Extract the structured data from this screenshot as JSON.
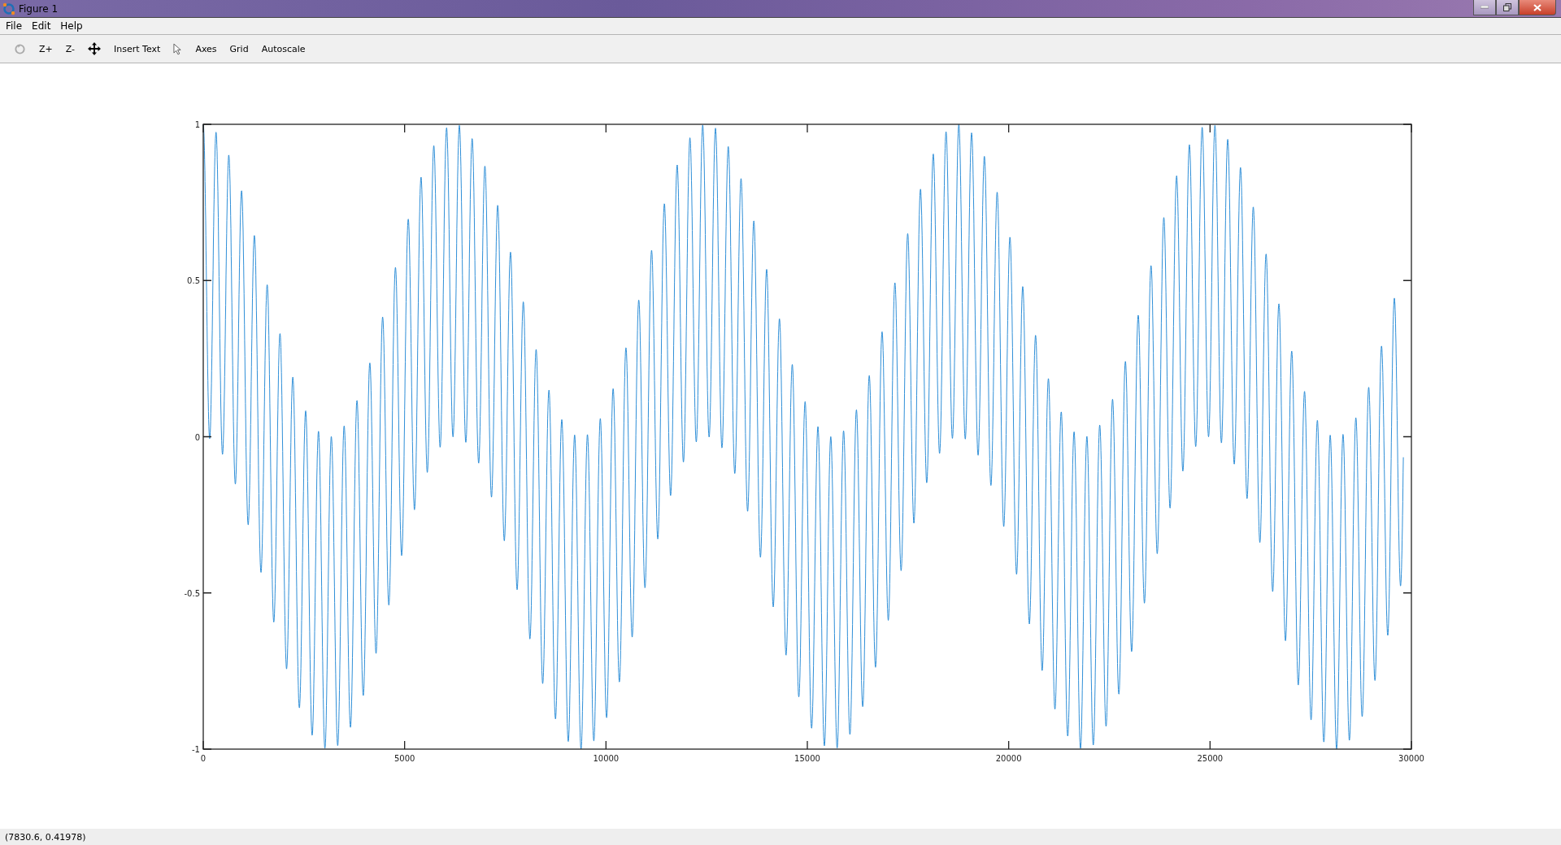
{
  "window": {
    "title": "Figure 1"
  },
  "menu": [
    "File",
    "Edit",
    "Help"
  ],
  "toolbar": [
    "Z+",
    "Z-",
    "Insert Text",
    "Axes",
    "Grid",
    "Autoscale"
  ],
  "plot": {
    "x_tick_labels": [
      "0",
      "5000",
      "10000",
      "15000",
      "20000",
      "25000",
      "30000"
    ],
    "y_tick_labels": [
      "1",
      "0.5",
      "0",
      "-0.5",
      "-1"
    ]
  },
  "status_bar": {
    "text": "(7830.6, 0.41978)"
  }
}
